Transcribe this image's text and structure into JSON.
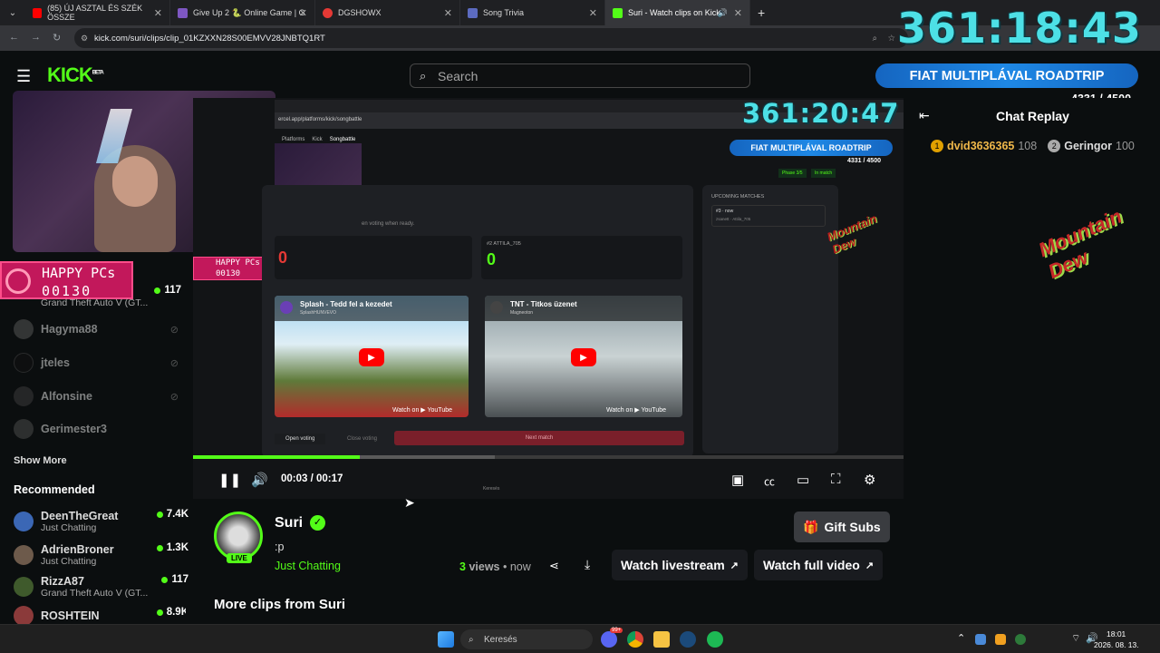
{
  "browser": {
    "tabs": [
      {
        "label": "(85) ÚJ ASZTAL ÉS SZÉK ÖSSZE",
        "favicon_color": "#ff0000"
      },
      {
        "label": "Give Up 2 🐍 Online Game | G",
        "favicon_color": "#7e57c2"
      },
      {
        "label": "DGSHOWX",
        "favicon_color": "#e53935"
      },
      {
        "label": "Song Trivia",
        "favicon_color": "#5c6bc0"
      },
      {
        "label": "Suri - Watch clips on Kick",
        "favicon_color": "#53fc18"
      }
    ],
    "new_tab": "+",
    "url": "kick.com/suri/clips/clip_01KZXXN28S00EMVV28JNBTQ1RT"
  },
  "overlay": {
    "timer_main": "361:18:43",
    "timer_inner": "361:20:47",
    "banner_main": "FIAT MULTIPLÁVAL ROADTRIP",
    "banner_count": "4331 / 4500",
    "banner_inner": "FIAT MULTIPLÁVAL ROADTRIP",
    "banner_inner_count": "4331 / 4500",
    "happy_top": "HAPPY PCs",
    "happy_bottom": "00130",
    "brand_text": "Mountain Dew"
  },
  "header": {
    "logo": "KICK",
    "logo_badge": "BETA",
    "search_placeholder": "Search"
  },
  "sidebar": {
    "following": [
      {
        "name": "",
        "category": "Grand Theft Auto V (GT...",
        "viewers": "117"
      },
      {
        "name": "Hagyma88",
        "category": "",
        "viewers": ""
      },
      {
        "name": "jteles",
        "category": "",
        "viewers": ""
      },
      {
        "name": "Alfonsine",
        "category": "",
        "viewers": ""
      },
      {
        "name": "Gerimester3",
        "category": "",
        "viewers": ""
      }
    ],
    "show_more": "Show More",
    "recommended_title": "Recommended",
    "recommended": [
      {
        "name": "DeenTheGreat",
        "category": "Just Chatting",
        "viewers": "7.4K"
      },
      {
        "name": "AdrienBroner",
        "category": "Just Chatting",
        "viewers": "1.3K"
      },
      {
        "name": "RizzA87",
        "category": "Grand Theft Auto V (GT...",
        "viewers": "117"
      },
      {
        "name": "ROSHTEIN",
        "category": "",
        "viewers": "8.9K"
      }
    ]
  },
  "inner_app": {
    "nav": [
      "Platforms",
      "Kick",
      "Songbattle"
    ],
    "phase": "Phase 3/5",
    "in_match": "In match",
    "voting_hint": "en voting when ready.",
    "left_score_label": "",
    "left_score": "0",
    "right_score_label": "#2 ATTILA_705",
    "right_score": "0",
    "upcoming_title": "UPCOMING MATCHES",
    "upcoming_item": "#3 · now",
    "upcoming_sub": "zsanett · Attila_705",
    "video1_title": "Splash - Tedd fel a kezedet",
    "video1_channel": "SplashHUNVEVO",
    "video2_title": "TNT - Titkos üzenet",
    "video2_channel": "Magneoton",
    "watch_on": "Watch on ▶ YouTube",
    "open_voting": "Open voting",
    "close_voting": "Close voting",
    "next_match": "Next match",
    "inner_search": "Keresés"
  },
  "player": {
    "time_current": "00:03",
    "time_total": "00:17",
    "progress": 0.235,
    "buffered": 0.425
  },
  "chat": {
    "title": "Chat Replay",
    "leaders": [
      {
        "rank": "1",
        "name": "dvid3636365",
        "score": "108"
      },
      {
        "rank": "2",
        "name": "Geringor",
        "score": "100"
      }
    ]
  },
  "clip": {
    "channel": "Suri",
    "title": ":p",
    "category": "Just Chatting",
    "live": "LIVE",
    "views_count": "3",
    "views_label": "views",
    "time_ago": "now",
    "gift_subs": "Gift Subs",
    "watch_livestream": "Watch livestream",
    "watch_full_video": "Watch full video",
    "more_clips": "More clips from Suri"
  },
  "taskbar": {
    "search": "Keresés",
    "time": "18:01",
    "date": "2026. 08. 13.",
    "badge": "99+"
  }
}
